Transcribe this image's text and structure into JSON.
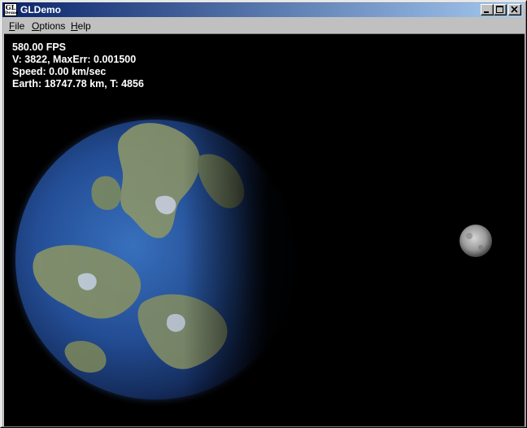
{
  "window": {
    "title": "GLDemo",
    "icon_text_top": "GL",
    "icon_text_bottom": "Demo"
  },
  "titlebar_buttons": [
    "minimize-icon",
    "maximize-icon",
    "close-icon"
  ],
  "menu": {
    "items": [
      {
        "label_prefix": "",
        "mnemonic": "F",
        "label_rest": "ile"
      },
      {
        "label_prefix": "",
        "mnemonic": "O",
        "label_rest": "ptions"
      },
      {
        "label_prefix": "",
        "mnemonic": "H",
        "label_rest": "elp"
      }
    ]
  },
  "hud": {
    "fps": "580.00 FPS",
    "vertices": "V: 3822, MaxErr: 0.001500",
    "speed": "Speed: 0.00 km/sec",
    "earth": "Earth: 18747.78 km, T: 4856"
  },
  "colors": {
    "title_start": "#0a246a",
    "title_end": "#a6caf0",
    "space": "#000000",
    "ocean": "#2a5aa8",
    "land": "#8a9a6a"
  }
}
